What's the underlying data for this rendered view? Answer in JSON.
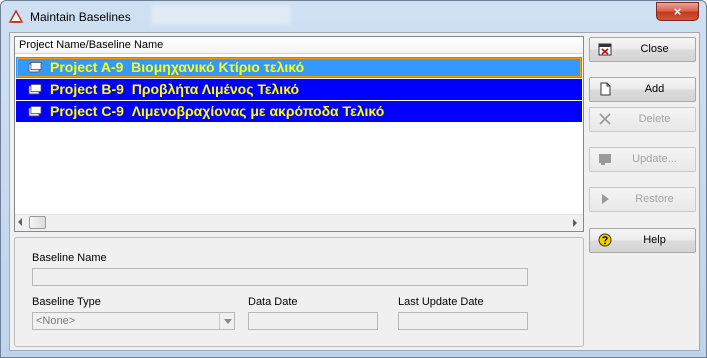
{
  "window": {
    "title": "Maintain Baselines",
    "close_glyph": "×"
  },
  "list": {
    "column_header": "Project Name/Baseline Name",
    "rows": [
      {
        "id": "Project A-9",
        "name": "Βιομηχανικό Κτίριο τελικό",
        "icon": "baseline-icon",
        "state": "focused"
      },
      {
        "id": "Project B-9",
        "name": "Προβλήτα Λιμένος Τελικό",
        "icon": "baseline-icon",
        "state": "selected"
      },
      {
        "id": "Project C-9",
        "name": "Λιμενοβραχίονας με ακρόποδα Τελικό",
        "icon": "baseline-icon",
        "state": "selected"
      }
    ]
  },
  "details": {
    "baseline_name_label": "Baseline Name",
    "baseline_name_value": "",
    "baseline_type_label": "Baseline Type",
    "baseline_type_value": "<None>",
    "data_date_label": "Data Date",
    "data_date_value": "",
    "last_update_label": "Last Update Date",
    "last_update_value": ""
  },
  "buttons": {
    "close": {
      "label": "Close",
      "icon": "close-dialog-icon",
      "enabled": true
    },
    "add": {
      "label": "Add",
      "icon": "new-document-icon",
      "enabled": true
    },
    "delete": {
      "label": "Delete",
      "icon": "delete-x-icon",
      "enabled": false
    },
    "update": {
      "label": "Update...",
      "icon": "update-icon",
      "enabled": false
    },
    "restore": {
      "label": "Restore",
      "icon": "play-arrow-icon",
      "enabled": false
    },
    "help": {
      "label": "Help",
      "icon": "help-question-icon",
      "enabled": true
    }
  },
  "colors": {
    "row_selected_bg": "#0000ff",
    "row_focused_bg": "#3399ff",
    "row_text": "#ffff00",
    "focus_outline": "#ff9900"
  }
}
